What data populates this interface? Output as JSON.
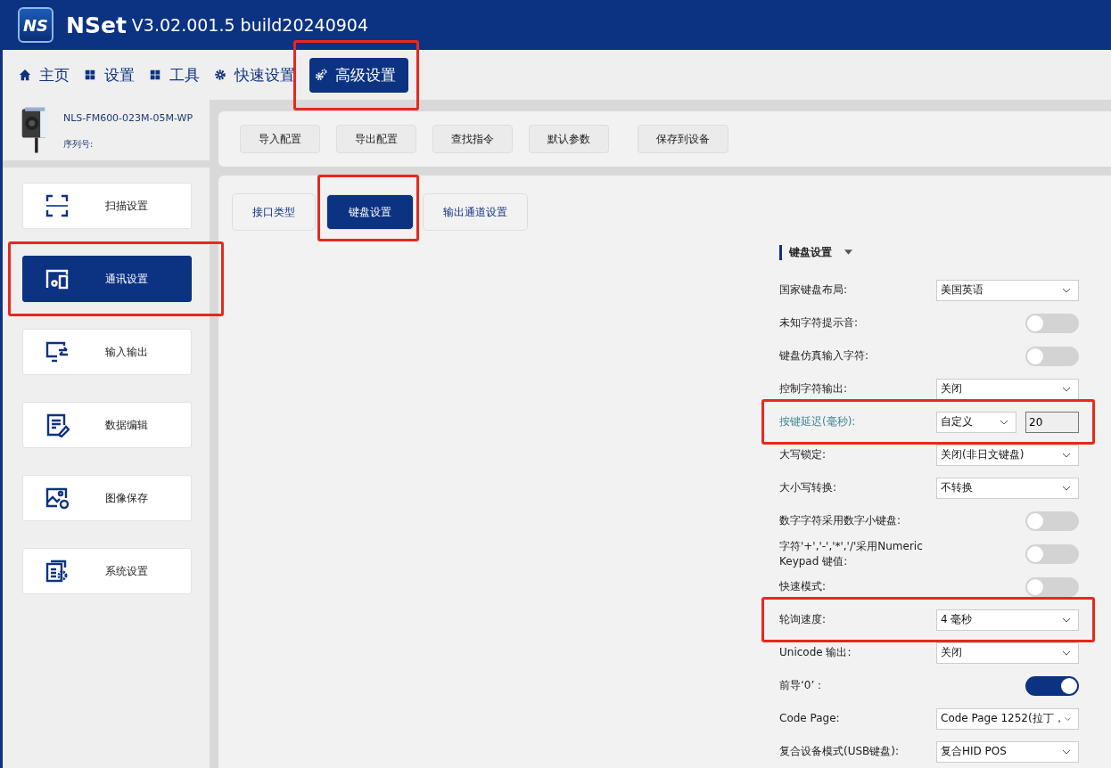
{
  "header": {
    "logo": "NS",
    "app_name": "NSet",
    "version": "V3.02.001.5 build20240904"
  },
  "nav": [
    {
      "label": "主页",
      "selected": false,
      "highlighted": false
    },
    {
      "label": "设置",
      "selected": false,
      "highlighted": false
    },
    {
      "label": "工具",
      "selected": false,
      "highlighted": false
    },
    {
      "label": "快速设置",
      "selected": false,
      "highlighted": false
    },
    {
      "label": "高级设置",
      "selected": true,
      "highlighted": true
    }
  ],
  "device": {
    "model": "NLS-FM600-023M-05M-WP",
    "serial_label": "序列号:"
  },
  "sidebar": {
    "items": [
      {
        "label": "扫描设置",
        "selected": false,
        "highlighted": false
      },
      {
        "label": "通讯设置",
        "selected": true,
        "highlighted": true
      },
      {
        "label": "输入输出",
        "selected": false,
        "highlighted": false
      },
      {
        "label": "数据编辑",
        "selected": false,
        "highlighted": false
      },
      {
        "label": "图像保存",
        "selected": false,
        "highlighted": false
      },
      {
        "label": "系统设置",
        "selected": false,
        "highlighted": false
      }
    ]
  },
  "toolbar": [
    "导入配置",
    "导出配置",
    "查找指令",
    "默认参数",
    "保存到设备"
  ],
  "tabs": [
    {
      "label": "接口类型",
      "selected": false,
      "highlighted": false
    },
    {
      "label": "键盘设置",
      "selected": true,
      "highlighted": true
    },
    {
      "label": "输出通道设置",
      "selected": false,
      "highlighted": false
    }
  ],
  "section": {
    "title": "键盘设置",
    "expanded": true
  },
  "settings": [
    {
      "kind": "select",
      "label": "国家键盘布局:",
      "value": "美国英语",
      "emphasized": false,
      "highlighted": false
    },
    {
      "kind": "toggle",
      "label": "未知字符提示音:",
      "on": false,
      "emphasized": false,
      "highlighted": false
    },
    {
      "kind": "toggle",
      "label": "键盘仿真输入字符:",
      "on": false,
      "emphasized": false,
      "highlighted": false
    },
    {
      "kind": "select",
      "label": "控制字符输出:",
      "value": "关闭",
      "emphasized": false,
      "highlighted": false
    },
    {
      "kind": "select_input",
      "label": "按键延迟(毫秒):",
      "value": "自定义",
      "input": "20",
      "emphasized": true,
      "highlighted": true
    },
    {
      "kind": "select",
      "label": "大写锁定:",
      "value": "关闭(非日文键盘)",
      "emphasized": false,
      "highlighted": false
    },
    {
      "kind": "select",
      "label": "大小写转换:",
      "value": "不转换",
      "emphasized": false,
      "highlighted": false
    },
    {
      "kind": "toggle",
      "label": "数字字符采用数字小键盘:",
      "on": false,
      "emphasized": false,
      "highlighted": false
    },
    {
      "kind": "toggle",
      "label": "字符'+','-','*','/'采用Numeric Keypad 键值:",
      "on": false,
      "emphasized": false,
      "highlighted": false
    },
    {
      "kind": "toggle",
      "label": "快速模式:",
      "on": false,
      "emphasized": false,
      "highlighted": false
    },
    {
      "kind": "select",
      "label": "轮询速度:",
      "value": "4 毫秒",
      "emphasized": false,
      "highlighted": true
    },
    {
      "kind": "select",
      "label": "Unicode 输出:",
      "value": "关闭",
      "emphasized": false,
      "highlighted": false
    },
    {
      "kind": "toggle",
      "label": "前导‘0’：",
      "on": true,
      "emphasized": false,
      "highlighted": false
    },
    {
      "kind": "select",
      "label": "Code Page:",
      "value": "Code Page 1252(拉丁，",
      "emphasized": false,
      "highlighted": false
    },
    {
      "kind": "select",
      "label": "复合设备模式(USB键盘):",
      "value": "复合HID POS",
      "emphasized": false,
      "highlighted": false
    }
  ]
}
